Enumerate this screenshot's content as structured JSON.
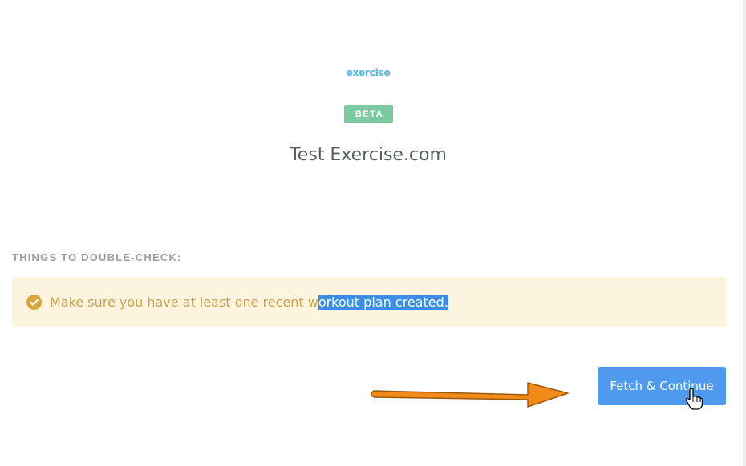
{
  "app": {
    "logo_text": "exercise",
    "badge": "BETA",
    "title": "Test Exercise.com"
  },
  "checklist": {
    "heading": "THINGS TO DOUBLE-CHECK:",
    "item_before_selection": "Make sure you have at least one recent w",
    "item_selected": "orkout plan created."
  },
  "actions": {
    "fetch_continue_label": "Fetch & Continue"
  },
  "colors": {
    "accent_button": "#4f9aee",
    "badge": "#7ecaa0",
    "notice_background": "#fdf4e0",
    "notice_text": "#c9a24d",
    "annotation_arrow": "#f28a1a"
  },
  "icons": {
    "notice": "check-circle-icon",
    "annotation": "orange-arrow-icon",
    "cursor": "hand-pointer-icon"
  }
}
